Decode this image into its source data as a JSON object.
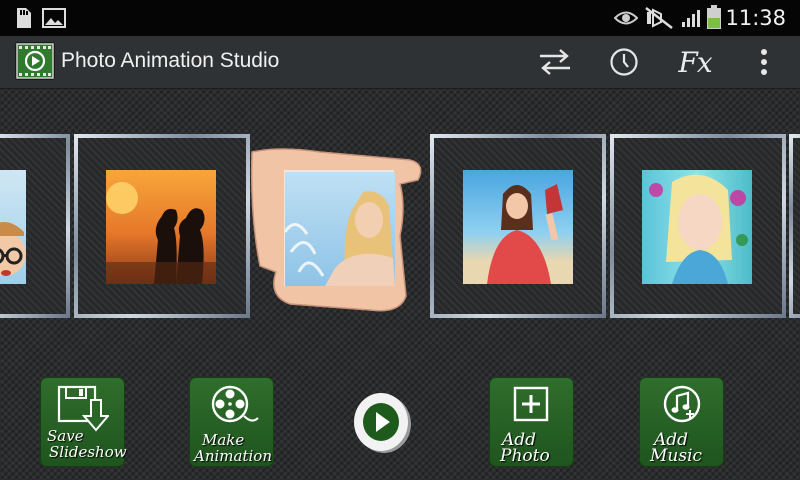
{
  "status_bar": {
    "time": "11:38",
    "left_icons": [
      "sd-card-icon",
      "image-icon"
    ],
    "right_icons": [
      "eye-icon",
      "mute-icon",
      "signal-icon",
      "battery-icon"
    ]
  },
  "action_bar": {
    "title": "Photo Animation Studio",
    "actions": [
      {
        "name": "swap-icon"
      },
      {
        "name": "clock-icon"
      },
      {
        "name": "fx-icon",
        "label": "Fx"
      },
      {
        "name": "overflow-menu-icon"
      }
    ]
  },
  "toolbar": {
    "save_line1": "Save",
    "save_line2": "Slideshow",
    "make_line1": "Make",
    "make_line2": "Animation",
    "add_photo_line1": "Add",
    "add_photo_line2": "Photo",
    "add_music_line1": "Add",
    "add_music_line2": "Music"
  },
  "colors": {
    "button_green": "#2a6627",
    "accent_green": "#7bc043",
    "frame_silver": "#a9b4c2"
  }
}
